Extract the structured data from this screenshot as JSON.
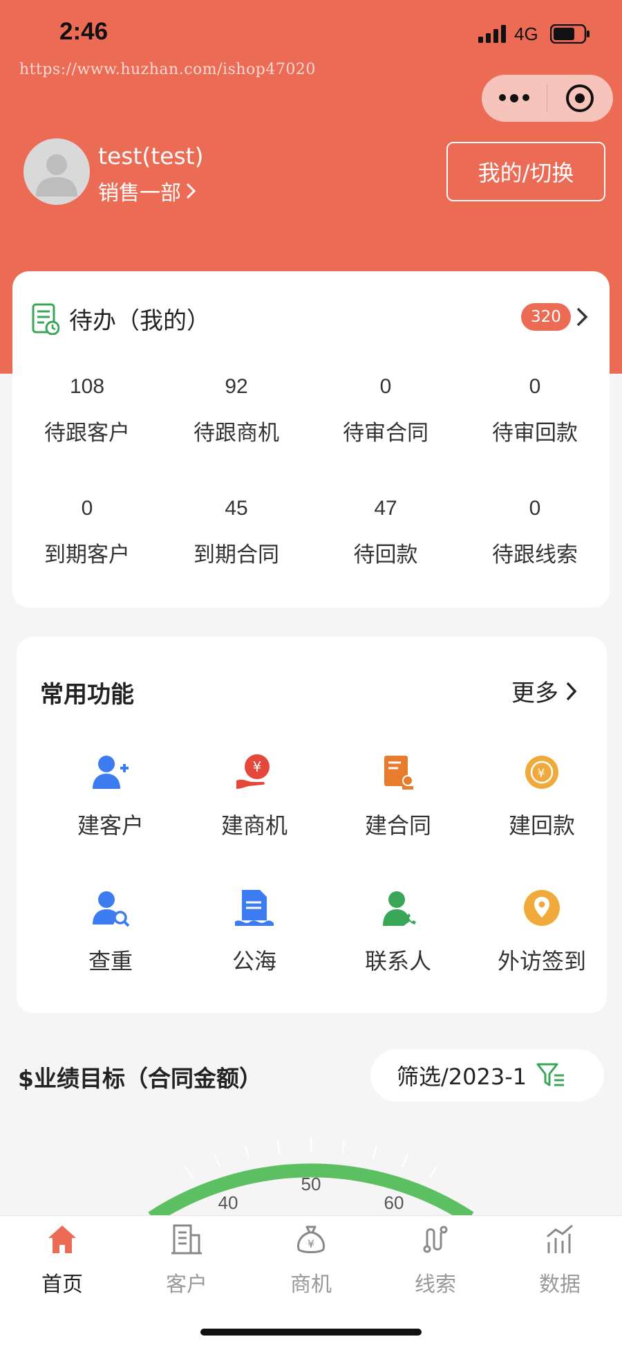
{
  "status_bar": {
    "time": "2:46",
    "network": "4G"
  },
  "watermark": "https://www.huzhan.com/ishop47020",
  "user": {
    "name": "test(test)",
    "department": "销售一部",
    "switch_label": "我的/切换"
  },
  "todo": {
    "title": "待办（我的）",
    "badge": "320",
    "items": [
      {
        "value": "108",
        "label": "待跟客户"
      },
      {
        "value": "92",
        "label": "待跟商机"
      },
      {
        "value": "0",
        "label": "待审合同"
      },
      {
        "value": "0",
        "label": "待审回款"
      },
      {
        "value": "0",
        "label": "到期客户"
      },
      {
        "value": "45",
        "label": "到期合同"
      },
      {
        "value": "47",
        "label": "待回款"
      },
      {
        "value": "0",
        "label": "待跟线索"
      }
    ]
  },
  "functions": {
    "title": "常用功能",
    "more_label": "更多",
    "items": [
      {
        "label": "建客户",
        "icon": "add-user-icon"
      },
      {
        "label": "建商机",
        "icon": "opportunity-icon"
      },
      {
        "label": "建合同",
        "icon": "contract-icon"
      },
      {
        "label": "建回款",
        "icon": "payment-icon"
      },
      {
        "label": "查重",
        "icon": "user-search-icon"
      },
      {
        "label": "公海",
        "icon": "public-pool-icon"
      },
      {
        "label": "联系人",
        "icon": "contact-icon"
      },
      {
        "label": "外访签到",
        "icon": "location-icon"
      }
    ]
  },
  "performance": {
    "title": "$业绩目标（合同金额）",
    "filter_label": "筛选/2023-1",
    "gauge_ticks": [
      "40",
      "50",
      "60"
    ]
  },
  "tabbar": {
    "items": [
      {
        "label": "首页",
        "icon": "home-icon",
        "active": true
      },
      {
        "label": "客户",
        "icon": "building-icon",
        "active": false
      },
      {
        "label": "商机",
        "icon": "money-bag-icon",
        "active": false
      },
      {
        "label": "线索",
        "icon": "route-icon",
        "active": false
      },
      {
        "label": "数据",
        "icon": "chart-icon",
        "active": false
      }
    ]
  },
  "colors": {
    "brand": "#ec6b55",
    "gauge": "#5cc062",
    "icon_blue": "#3d7cf0",
    "icon_green": "#3aa657",
    "icon_gold": "#f0a93b"
  }
}
